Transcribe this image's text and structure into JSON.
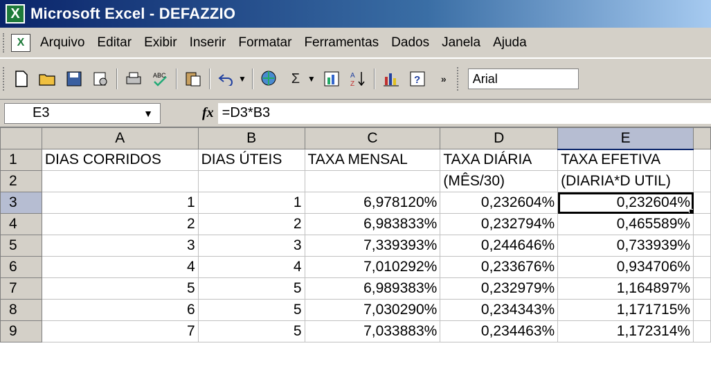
{
  "window": {
    "title": "Microsoft Excel - DEFAZZIO"
  },
  "menu": {
    "items": [
      "Arquivo",
      "Editar",
      "Exibir",
      "Inserir",
      "Formatar",
      "Ferramentas",
      "Dados",
      "Janela",
      "Ajuda"
    ]
  },
  "toolbar": {
    "font_name": "Arial",
    "buttons": [
      "new-document-icon",
      "open-folder-icon",
      "save-icon",
      "permission-icon",
      "print-icon",
      "spell-check-icon",
      "paste-icon",
      "undo-icon",
      "hyperlink-icon",
      "autosum-icon",
      "chart-wizard-icon",
      "sort-ascending-icon",
      "chart-icon",
      "help-icon",
      "more-options-icon"
    ],
    "sigma_glyph": "Σ"
  },
  "formula_bar": {
    "name_box": "E3",
    "fx_label": "fx",
    "formula": "=D3*B3"
  },
  "sheet": {
    "column_headers": [
      "A",
      "B",
      "C",
      "D",
      "E"
    ],
    "active_column": "E",
    "active_row": "3",
    "rows": [
      {
        "num": "1",
        "cells": [
          "DIAS CORRIDOS",
          "DIAS ÚTEIS",
          "TAXA MENSAL",
          "TAXA DIÁRIA",
          "TAXA EFETIVA"
        ]
      },
      {
        "num": "2",
        "cells": [
          "",
          "",
          "",
          "(MÊS/30)",
          "(DIARIA*D UTIL)"
        ]
      },
      {
        "num": "3",
        "cells": [
          "1",
          "1",
          "6,978120%",
          "0,232604%",
          "0,232604%"
        ]
      },
      {
        "num": "4",
        "cells": [
          "2",
          "2",
          "6,983833%",
          "0,232794%",
          "0,465589%"
        ]
      },
      {
        "num": "5",
        "cells": [
          "3",
          "3",
          "7,339393%",
          "0,244646%",
          "0,733939%"
        ]
      },
      {
        "num": "6",
        "cells": [
          "4",
          "4",
          "7,010292%",
          "0,233676%",
          "0,934706%"
        ]
      },
      {
        "num": "7",
        "cells": [
          "5",
          "5",
          "6,989383%",
          "0,232979%",
          "1,164897%"
        ]
      },
      {
        "num": "8",
        "cells": [
          "6",
          "5",
          "7,030290%",
          "0,234343%",
          "1,171715%"
        ]
      },
      {
        "num": "9",
        "cells": [
          "7",
          "5",
          "7,033883%",
          "0,234463%",
          "1,172314%"
        ]
      }
    ]
  }
}
